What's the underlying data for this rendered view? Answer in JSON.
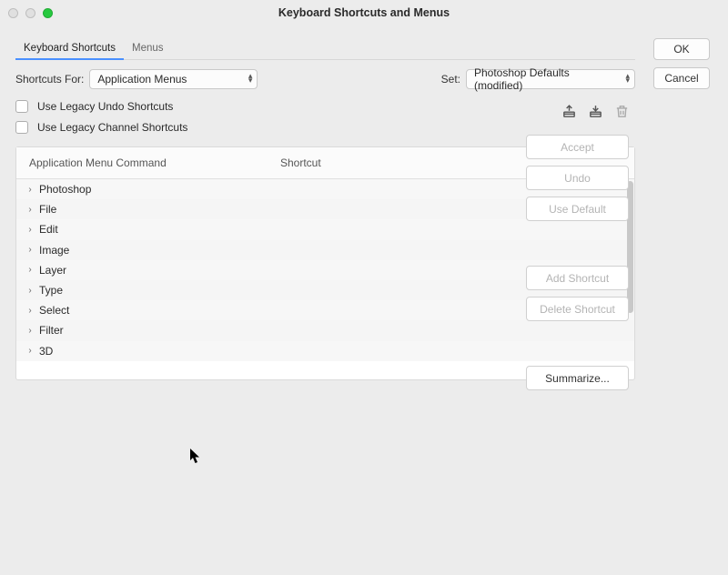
{
  "window": {
    "title": "Keyboard Shortcuts and Menus"
  },
  "tabs": {
    "keyboard": "Keyboard Shortcuts",
    "menus": "Menus"
  },
  "shortcutsFor": {
    "label": "Shortcuts For:",
    "value": "Application Menus"
  },
  "set": {
    "label": "Set:",
    "value": "Photoshop Defaults (modified)"
  },
  "checks": {
    "legacyUndo": "Use Legacy Undo Shortcuts",
    "legacyChannel": "Use Legacy Channel Shortcuts"
  },
  "table": {
    "col1": "Application Menu Command",
    "col2": "Shortcut",
    "rows": [
      "Photoshop",
      "File",
      "Edit",
      "Image",
      "Layer",
      "Type",
      "Select",
      "Filter",
      "3D"
    ]
  },
  "icons": {
    "save": "save-set-icon",
    "saveAs": "save-set-as-icon",
    "trash": "delete-set-icon"
  },
  "buttons": {
    "ok": "OK",
    "cancel": "Cancel",
    "accept": "Accept",
    "undo": "Undo",
    "useDefault": "Use Default",
    "addShortcut": "Add Shortcut",
    "deleteShortcut": "Delete Shortcut",
    "summarize": "Summarize..."
  }
}
